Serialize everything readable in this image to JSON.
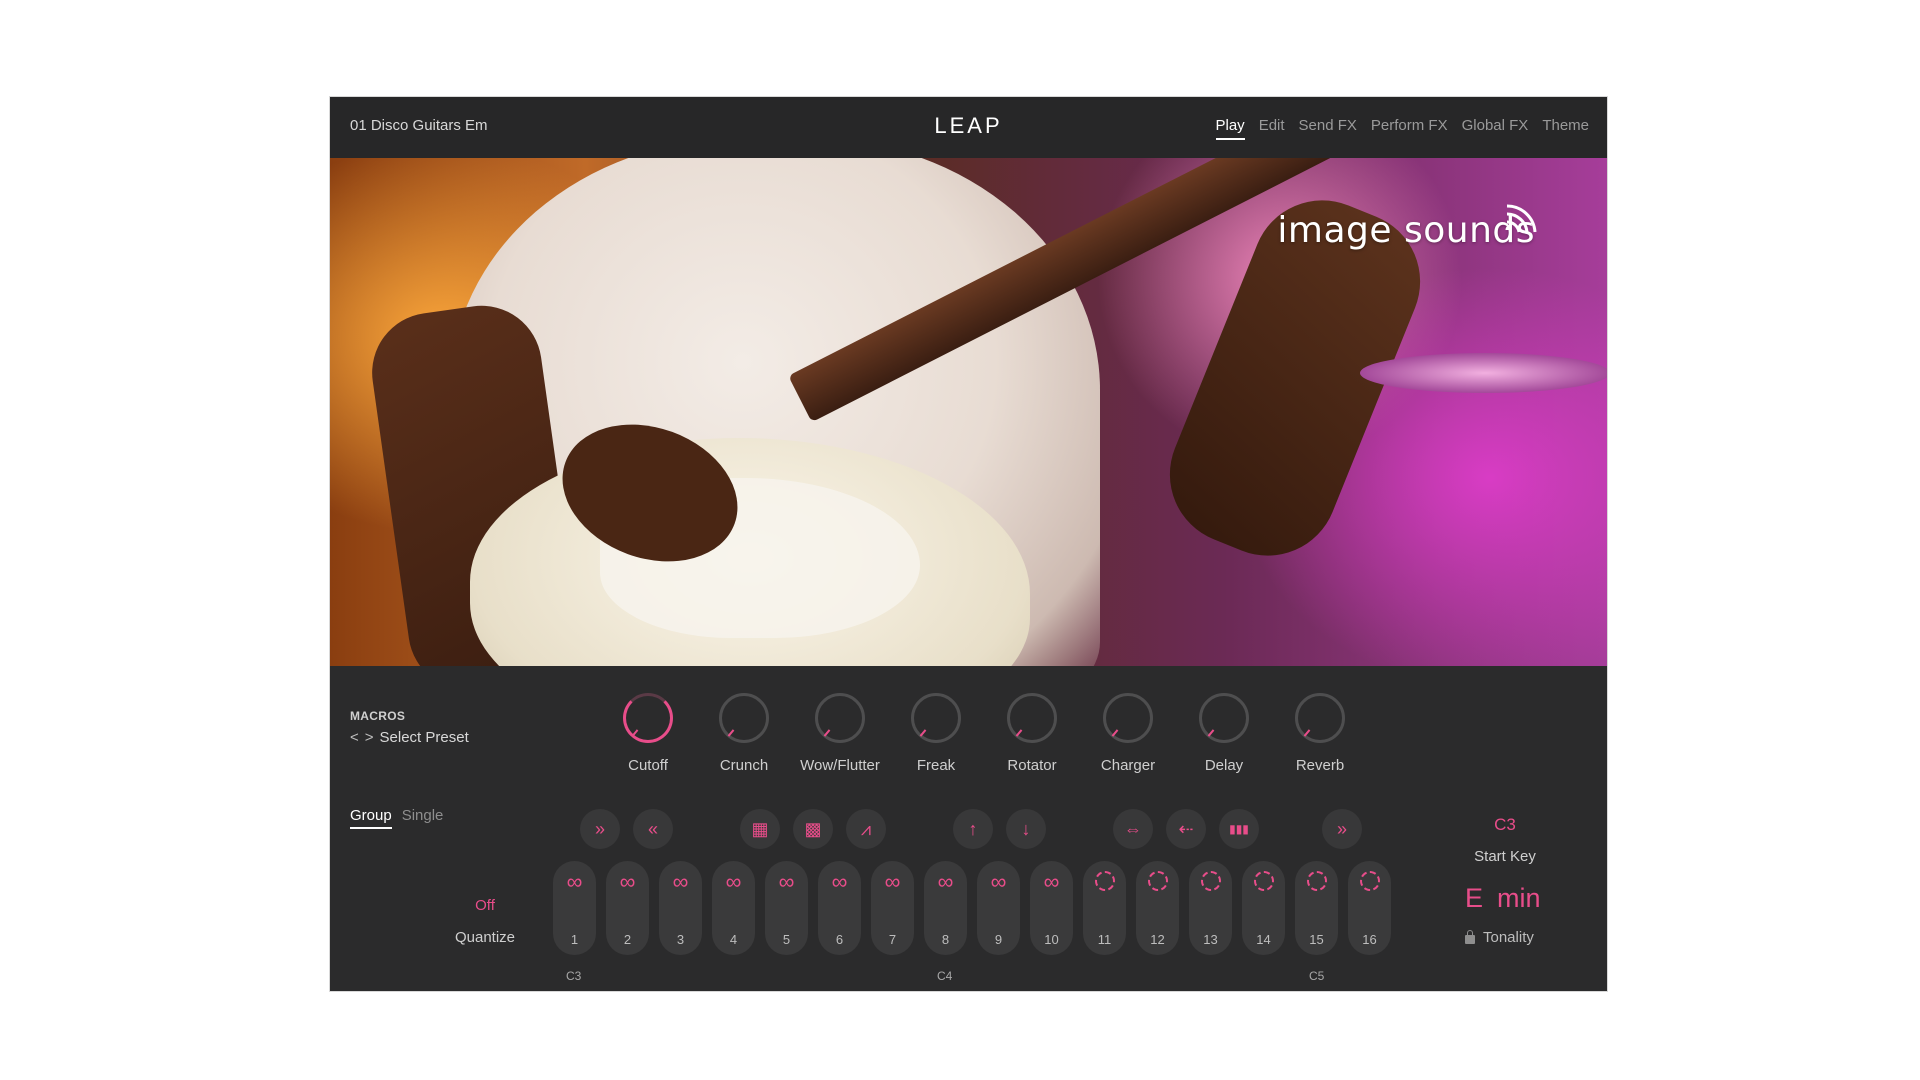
{
  "header": {
    "preset_name": "01 Disco Guitars Em",
    "logo": "LEAP",
    "tabs": [
      {
        "label": "Play",
        "active": true
      },
      {
        "label": "Edit",
        "active": false
      },
      {
        "label": "Send FX",
        "active": false
      },
      {
        "label": "Perform FX",
        "active": false
      },
      {
        "label": "Global FX",
        "active": false
      },
      {
        "label": "Theme",
        "active": false
      }
    ]
  },
  "hero": {
    "brand": "image sounds"
  },
  "macros": {
    "section_label": "MACROS",
    "select_preset": "Select Preset",
    "knobs": [
      {
        "label": "Cutoff",
        "active": true
      },
      {
        "label": "Crunch",
        "active": false
      },
      {
        "label": "Wow/Flutter",
        "active": false
      },
      {
        "label": "Freak",
        "active": false
      },
      {
        "label": "Rotator",
        "active": false
      },
      {
        "label": "Charger",
        "active": false
      },
      {
        "label": "Delay",
        "active": false
      },
      {
        "label": "Reverb",
        "active": false
      }
    ]
  },
  "mode": {
    "tabs": [
      {
        "label": "Group",
        "active": true
      },
      {
        "label": "Single",
        "active": false
      }
    ]
  },
  "quantize": {
    "value": "Off",
    "label": "Quantize"
  },
  "tools": [
    {
      "icon": "fast-forward-icon",
      "glyph": "»"
    },
    {
      "icon": "rewind-icon",
      "glyph": "«"
    },
    {
      "icon": "slice-grid-icon",
      "glyph": "▦"
    },
    {
      "icon": "slice-dense-icon",
      "glyph": "▩"
    },
    {
      "icon": "envelope-icon",
      "glyph": "⩘"
    },
    {
      "icon": "pitch-up-icon",
      "glyph": "↑"
    },
    {
      "icon": "pitch-down-icon",
      "glyph": "↓"
    },
    {
      "icon": "stretch-icon",
      "glyph": "⇔"
    },
    {
      "icon": "reverse-icon",
      "glyph": "⇠"
    },
    {
      "icon": "stutter-icon",
      "glyph": "▮▮▮"
    },
    {
      "icon": "fast-forward-icon",
      "glyph": "»"
    }
  ],
  "pads": [
    {
      "num": "1",
      "loop": true
    },
    {
      "num": "2",
      "loop": true
    },
    {
      "num": "3",
      "loop": true
    },
    {
      "num": "4",
      "loop": true
    },
    {
      "num": "5",
      "loop": true
    },
    {
      "num": "6",
      "loop": true
    },
    {
      "num": "7",
      "loop": true
    },
    {
      "num": "8",
      "loop": true
    },
    {
      "num": "9",
      "loop": true
    },
    {
      "num": "10",
      "loop": true
    },
    {
      "num": "11",
      "loop": false
    },
    {
      "num": "12",
      "loop": false
    },
    {
      "num": "13",
      "loop": false
    },
    {
      "num": "14",
      "loop": false
    },
    {
      "num": "15",
      "loop": false
    },
    {
      "num": "16",
      "loop": false
    }
  ],
  "octaves": [
    "C3",
    "C4",
    "C5"
  ],
  "start_key": {
    "value": "C3",
    "label": "Start Key"
  },
  "tonality": {
    "key": "E",
    "mode": "min",
    "label": "Tonality"
  },
  "colors": {
    "accent": "#e84d8a",
    "panel": "#2b2b2c"
  }
}
